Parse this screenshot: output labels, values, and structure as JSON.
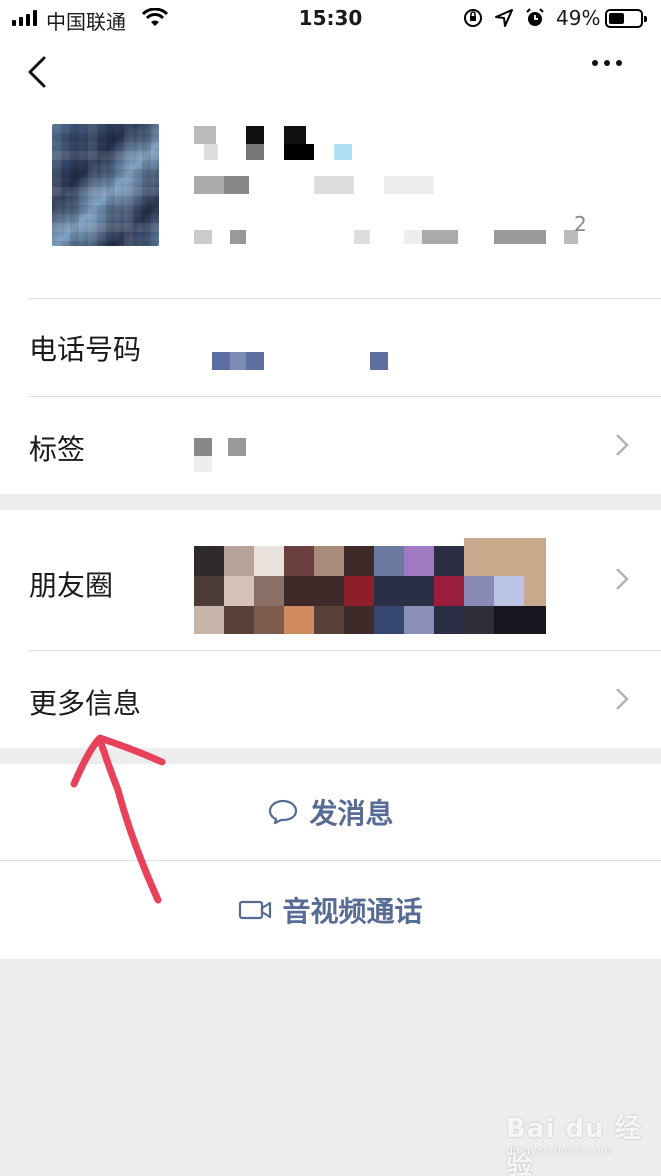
{
  "status_bar": {
    "carrier": "中国联通",
    "time": "15:30",
    "battery_percent": "49%",
    "battery_level": 0.49
  },
  "nav": {
    "back_icon": "chevron-left-icon",
    "more_icon": "more-dots-icon"
  },
  "profile": {
    "superscript": "2"
  },
  "rows": {
    "phone_label": "电话号码",
    "tags_label": "标签",
    "moments_label": "朋友圈",
    "more_info_label": "更多信息"
  },
  "actions": {
    "message_label": "发消息",
    "call_label": "音视频通话"
  },
  "colors": {
    "link": "#576b95",
    "annotation": "#e8415a",
    "background": "#ededed"
  },
  "watermark": {
    "text": "Bai du 经验",
    "sub": "jingyan.baidu.com"
  }
}
